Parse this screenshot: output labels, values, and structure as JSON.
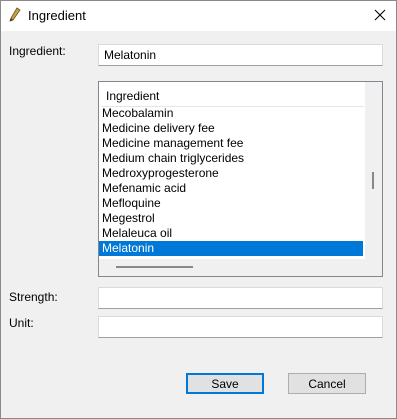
{
  "window": {
    "title": "Ingredient",
    "icon": "pencil-icon",
    "close_icon": "close-icon"
  },
  "form": {
    "ingredient_label": "Ingredient:",
    "ingredient_value": "Melatonin",
    "strength_label": "Strength:",
    "strength_value": "",
    "unit_label": "Unit:",
    "unit_value": ""
  },
  "list": {
    "header": "Ingredient",
    "items": [
      "Mecobalamin",
      "Medicine delivery fee",
      "Medicine management fee",
      "Medium chain triglycerides",
      "Medroxyprogesterone",
      "Mefenamic acid",
      "Mefloquine",
      "Megestrol",
      "Melaleuca oil",
      "Melatonin"
    ],
    "selected_index": 9
  },
  "buttons": {
    "save": "Save",
    "cancel": "Cancel"
  },
  "colors": {
    "selection": "#0078d7",
    "default_button_border": "#0078d7"
  }
}
